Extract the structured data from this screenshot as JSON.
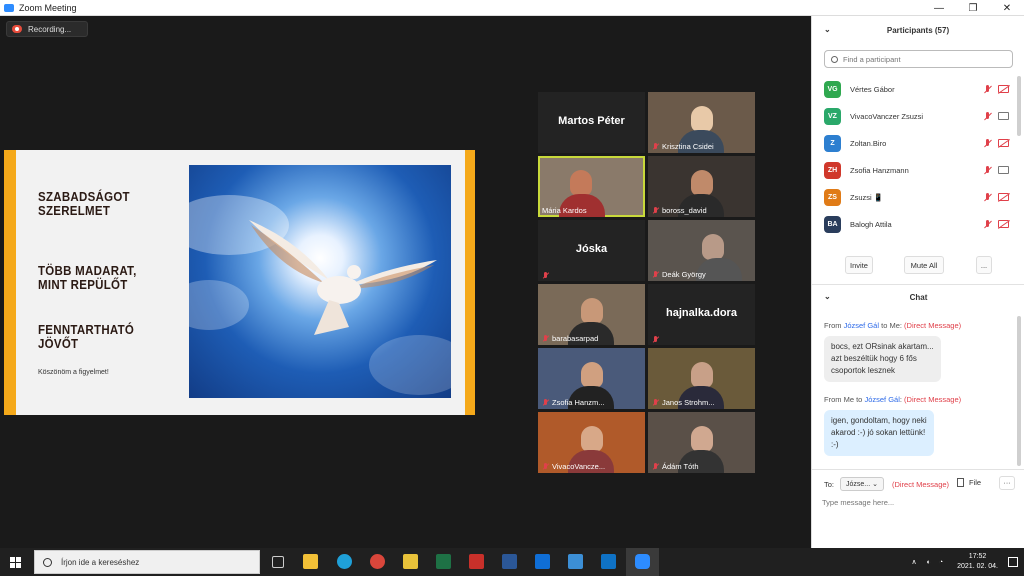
{
  "window": {
    "title": "Zoom Meeting",
    "controls": [
      "—",
      "❐",
      "✕"
    ]
  },
  "recording": {
    "label": "Recording..."
  },
  "slide": {
    "headings": [
      "SZABADSÁGOT\nSZERELMET",
      "TÖBB MADARAT,\nMINT REPÜLŐT",
      "FENNTARTHATÓ\nJÖVŐT"
    ],
    "thanks": "Köszönöm a figyelmet!"
  },
  "video_tiles": [
    {
      "name": "Martos Péter",
      "type": "name-only",
      "muted": false
    },
    {
      "name": "Krisztina Csidei",
      "type": "video",
      "muted": true
    },
    {
      "name": "Mária Kardos",
      "type": "video",
      "muted": false,
      "active_speaker": true
    },
    {
      "name": "boross_david",
      "type": "video",
      "muted": true
    },
    {
      "name": "Jóska",
      "type": "name-only",
      "muted": true
    },
    {
      "name": "Deák György",
      "type": "video",
      "muted": true
    },
    {
      "name": "barabasarpad",
      "type": "video",
      "muted": true
    },
    {
      "name": "hajnalka.dora",
      "type": "name-only",
      "muted": true
    },
    {
      "name": "Zsofia Hanzm...",
      "type": "video",
      "muted": true
    },
    {
      "name": "Janos Strohm...",
      "type": "video",
      "muted": true
    },
    {
      "name": "VivacoVancze...",
      "type": "video",
      "muted": true
    },
    {
      "name": "Ádám Tóth",
      "type": "video",
      "muted": true
    }
  ],
  "participants": {
    "header": "Participants (57)",
    "search_placeholder": "Find a participant",
    "list": [
      {
        "initials": "VG",
        "name": "Vértes Gábor",
        "color": "#2fa84f",
        "mic": "off",
        "cam": "off"
      },
      {
        "initials": "VZ",
        "name": "VivacoVanczer Zsuzsi",
        "color": "#2aa86a",
        "mic": "off",
        "cam": "on"
      },
      {
        "initials": "Z",
        "name": "Zoltan.Biro",
        "color": "#2d7fd0",
        "mic": "off",
        "cam": "off"
      },
      {
        "initials": "ZH",
        "name": "Zsofia Hanzmann",
        "color": "#d0382b",
        "mic": "off",
        "cam": "on"
      },
      {
        "initials": "ZS",
        "name": "Zsuzsi 📱",
        "color": "#e07b17",
        "mic": "off",
        "cam": "off"
      },
      {
        "initials": "BA",
        "name": "Balogh Attila",
        "color": "#2a3d5c",
        "mic": "off",
        "cam": "off"
      }
    ],
    "invite_label": "Invite",
    "mute_all_label": "Mute All",
    "more_label": "..."
  },
  "chat": {
    "header": "Chat",
    "messages": [
      {
        "from_prefix": "From ",
        "sender": "József Gál",
        "to": " to Me: ",
        "dm": "(Direct Message)",
        "text": "bocs, ezt ORsinak akartam...\nazt beszéltük hogy 6 fős\ncsoportok lesznek",
        "kind": "in"
      },
      {
        "from_prefix": "From Me to ",
        "sender": "József Gál",
        "to": ": ",
        "dm": "(Direct Message)",
        "text": "igen, gondoltam, hogy neki\nakarod :-) jó sokan lettünk!\n:-)",
        "kind": "out"
      }
    ],
    "to_label": "To:",
    "to_value": "Józse... ⌄",
    "to_dm": "(Direct Message)",
    "file_label": "File",
    "more_label": "···",
    "input_placeholder": "Type message here..."
  },
  "taskbar": {
    "search_placeholder": "Írjon ide a kereséshez",
    "time": "17:52",
    "date": "2021. 02. 04."
  }
}
